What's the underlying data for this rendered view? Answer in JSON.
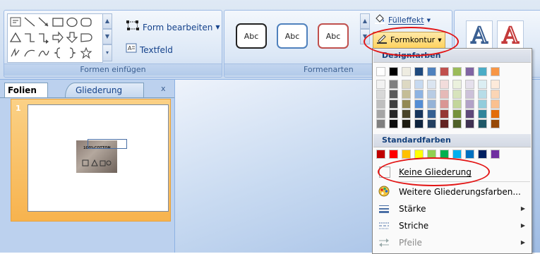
{
  "ribbon": {
    "insert_shapes_group": {
      "label": "Formen einfügen",
      "edit_shape_label": "Form bearbeiten",
      "textbox_label": "Textfeld",
      "shape_icons": [
        "rectangle-icon",
        "line-icon",
        "arrow-line-icon",
        "rounded-rect-icon",
        "oval-icon",
        "rounded-rect-2-icon",
        "triangle-icon",
        "elbow-connector-icon",
        "elbow-arrow-icon",
        "right-arrow-icon",
        "down-arrow-icon",
        "pentagon-icon",
        "freeform-icon",
        "arc-icon",
        "curve-icon",
        "left-brace-icon",
        "right-brace-icon",
        "star-icon"
      ]
    },
    "shape_styles_group": {
      "label": "Formenarten",
      "style_samples": [
        {
          "text": "Abc",
          "border": "#222222"
        },
        {
          "text": "Abc",
          "border": "#4f81bd"
        },
        {
          "text": "Abc",
          "border": "#c0504d"
        }
      ],
      "fill_effect_label": "Fülleffekt",
      "outline_label": "Formkontur"
    },
    "wordart_letters": [
      "A",
      "A"
    ]
  },
  "left_pane": {
    "tabs": [
      "Folien",
      "Gliederung"
    ],
    "close_label": "x",
    "slide_number": "1",
    "thumbnail_text": "100%COTTON"
  },
  "outline_menu": {
    "theme_colors_header": "Designfarben",
    "standard_colors_header": "Standardfarben",
    "theme_colors_top": [
      "#ffffff",
      "#000000",
      "#eeece1",
      "#1f497d",
      "#4f81bd",
      "#c0504d",
      "#9bbb59",
      "#8064a2",
      "#4bacc6",
      "#f79646"
    ],
    "theme_colors_shades": [
      [
        "#f2f2f2",
        "#d8d8d8",
        "#bfbfbf",
        "#a5a5a5",
        "#7f7f7f"
      ],
      [
        "#7f7f7f",
        "#595959",
        "#3f3f3f",
        "#262626",
        "#0c0c0c"
      ],
      [
        "#ddd9c3",
        "#c4bd97",
        "#938953",
        "#494429",
        "#1d1b10"
      ],
      [
        "#c6d9f0",
        "#8db3e2",
        "#548dd4",
        "#17365d",
        "#0f243e"
      ],
      [
        "#dbe5f1",
        "#b8cce4",
        "#95b3d7",
        "#366092",
        "#244061"
      ],
      [
        "#f2dcdb",
        "#e5b9b7",
        "#d99694",
        "#953734",
        "#632423"
      ],
      [
        "#ebf1dd",
        "#d7e3bc",
        "#c3d69b",
        "#76923c",
        "#4f6128"
      ],
      [
        "#e5e0ec",
        "#ccc1d9",
        "#b2a2c7",
        "#5f497a",
        "#3f3151"
      ],
      [
        "#dbeef3",
        "#b7dde8",
        "#92cddc",
        "#31859b",
        "#205867"
      ],
      [
        "#fdeada",
        "#fbd5b5",
        "#fac08f",
        "#e36c09",
        "#974806"
      ]
    ],
    "standard_colors": [
      "#c00000",
      "#ff0000",
      "#ffc000",
      "#ffff00",
      "#92d050",
      "#00b050",
      "#00b0f0",
      "#0070c0",
      "#002060",
      "#7030a0"
    ],
    "items": {
      "no_outline": "Keine Gliederung",
      "more_colors": "Weitere Gliederungsfarben...",
      "weight": "Stärke",
      "dashes": "Striche",
      "arrows": "Pfeile"
    },
    "highlight_color": "#e31414"
  }
}
